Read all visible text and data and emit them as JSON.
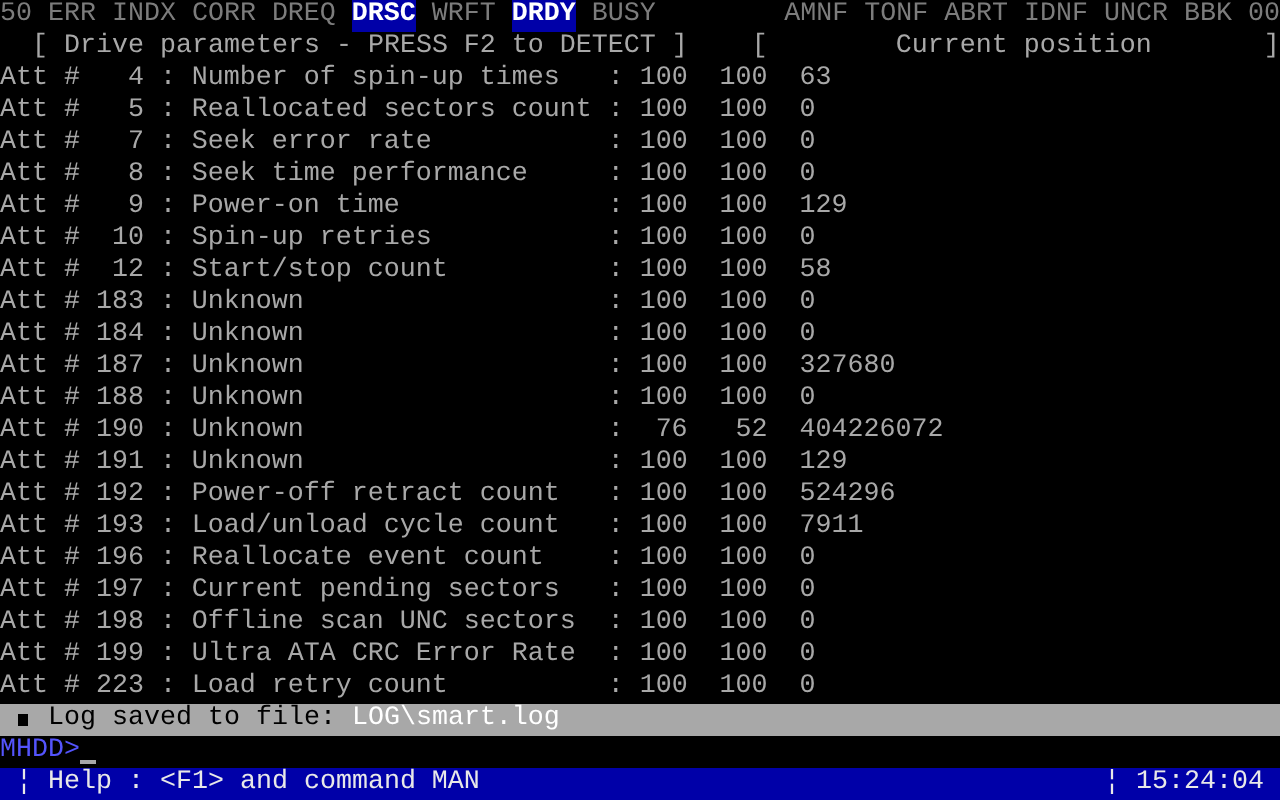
{
  "status_flags_left": [
    {
      "label": "50",
      "on": false
    },
    {
      "label": "ERR",
      "on": false
    },
    {
      "label": "INDX",
      "on": false
    },
    {
      "label": "CORR",
      "on": false
    },
    {
      "label": "DREQ",
      "on": false
    },
    {
      "label": "DRSC",
      "on": true
    },
    {
      "label": "WRFT",
      "on": false
    },
    {
      "label": "DRDY",
      "on": true
    },
    {
      "label": "BUSY",
      "on": false
    }
  ],
  "status_flags_right": [
    {
      "label": "AMNF",
      "on": false
    },
    {
      "label": "TONF",
      "on": false
    },
    {
      "label": "ABRT",
      "on": false
    },
    {
      "label": "IDNF",
      "on": false
    },
    {
      "label": "UNCR",
      "on": false
    },
    {
      "label": "BBK",
      "on": false
    },
    {
      "label": "00",
      "on": false
    }
  ],
  "header": {
    "left": "[ Drive parameters - PRESS F2 to DETECT ]",
    "right_open": "[",
    "right_title": "Current position",
    "right_close": "]"
  },
  "attributes": [
    {
      "label": "Att #",
      "id": "4",
      "sep_1": ":",
      "name": "Number of spin-up times",
      "sep_2": ":",
      "value": "100",
      "worst": "100",
      "raw": "63"
    },
    {
      "label": "Att #",
      "id": "5",
      "sep_1": ":",
      "name": "Reallocated sectors count",
      "sep_2": ":",
      "value": "100",
      "worst": "100",
      "raw": "0"
    },
    {
      "label": "Att #",
      "id": "7",
      "sep_1": ":",
      "name": "Seek error rate",
      "sep_2": ":",
      "value": "100",
      "worst": "100",
      "raw": "0"
    },
    {
      "label": "Att #",
      "id": "8",
      "sep_1": ":",
      "name": "Seek time performance",
      "sep_2": ":",
      "value": "100",
      "worst": "100",
      "raw": "0"
    },
    {
      "label": "Att #",
      "id": "9",
      "sep_1": ":",
      "name": "Power-on time",
      "sep_2": ":",
      "value": "100",
      "worst": "100",
      "raw": "129"
    },
    {
      "label": "Att #",
      "id": "10",
      "sep_1": ":",
      "name": "Spin-up retries",
      "sep_2": ":",
      "value": "100",
      "worst": "100",
      "raw": "0"
    },
    {
      "label": "Att #",
      "id": "12",
      "sep_1": ":",
      "name": "Start/stop count",
      "sep_2": ":",
      "value": "100",
      "worst": "100",
      "raw": "58"
    },
    {
      "label": "Att #",
      "id": "183",
      "sep_1": ":",
      "name": "Unknown",
      "sep_2": ":",
      "value": "100",
      "worst": "100",
      "raw": "0"
    },
    {
      "label": "Att #",
      "id": "184",
      "sep_1": ":",
      "name": "Unknown",
      "sep_2": ":",
      "value": "100",
      "worst": "100",
      "raw": "0"
    },
    {
      "label": "Att #",
      "id": "187",
      "sep_1": ":",
      "name": "Unknown",
      "sep_2": ":",
      "value": "100",
      "worst": "100",
      "raw": "327680"
    },
    {
      "label": "Att #",
      "id": "188",
      "sep_1": ":",
      "name": "Unknown",
      "sep_2": ":",
      "value": "100",
      "worst": "100",
      "raw": "0"
    },
    {
      "label": "Att #",
      "id": "190",
      "sep_1": ":",
      "name": "Unknown",
      "sep_2": ":",
      "value": "76",
      "worst": "52",
      "raw": "404226072"
    },
    {
      "label": "Att #",
      "id": "191",
      "sep_1": ":",
      "name": "Unknown",
      "sep_2": ":",
      "value": "100",
      "worst": "100",
      "raw": "129"
    },
    {
      "label": "Att #",
      "id": "192",
      "sep_1": ":",
      "name": "Power-off retract count",
      "sep_2": ":",
      "value": "100",
      "worst": "100",
      "raw": "524296"
    },
    {
      "label": "Att #",
      "id": "193",
      "sep_1": ":",
      "name": "Load/unload cycle count",
      "sep_2": ":",
      "value": "100",
      "worst": "100",
      "raw": "7911"
    },
    {
      "label": "Att #",
      "id": "196",
      "sep_1": ":",
      "name": "Reallocate event count",
      "sep_2": ":",
      "value": "100",
      "worst": "100",
      "raw": "0"
    },
    {
      "label": "Att #",
      "id": "197",
      "sep_1": ":",
      "name": "Current pending sectors",
      "sep_2": ":",
      "value": "100",
      "worst": "100",
      "raw": "0"
    },
    {
      "label": "Att #",
      "id": "198",
      "sep_1": ":",
      "name": "Offline scan UNC sectors",
      "sep_2": ":",
      "value": "100",
      "worst": "100",
      "raw": "0"
    },
    {
      "label": "Att #",
      "id": "199",
      "sep_1": ":",
      "name": "Ultra ATA CRC Error Rate",
      "sep_2": ":",
      "value": "100",
      "worst": "100",
      "raw": "0"
    },
    {
      "label": "Att #",
      "id": "223",
      "sep_1": ":",
      "name": "Load retry count",
      "sep_2": ":",
      "value": "100",
      "worst": "100",
      "raw": "0"
    }
  ],
  "log_bar": {
    "message": "Log saved to file:",
    "path": "LOG\\smart.log"
  },
  "prompt": "MHDD>",
  "status_bar": {
    "help": "¦ Help : <F1> and command MAN",
    "time": "¦ 15:24:04"
  }
}
